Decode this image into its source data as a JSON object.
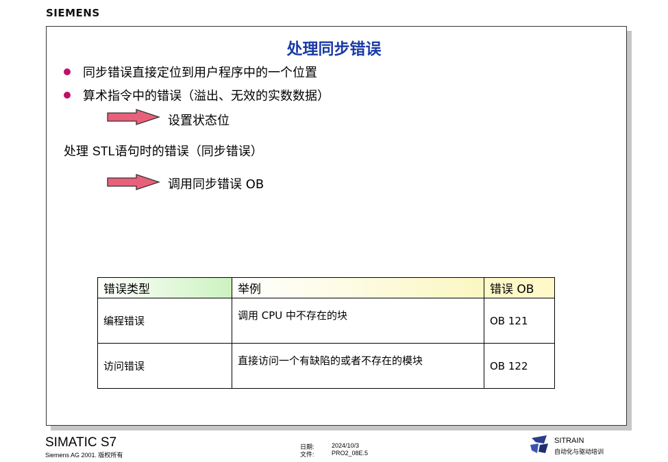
{
  "header": {
    "logo_text": "SIEMENS"
  },
  "slide": {
    "title": "处理同步错误",
    "bullets": [
      "同步错误直接定位到用户程序中的一个位置",
      "算术指令中的错误（溢出、无效的实数数据）"
    ],
    "arrow1_text": "设置状态位",
    "line_prefix": "处理 ",
    "line_stl": "STL",
    "line_suffix": "语句时的错误（同步错误）",
    "arrow2_text": "调用同步错误 OB"
  },
  "table": {
    "headers": [
      "错误类型",
      "举例",
      "错误 OB"
    ],
    "rows": [
      {
        "type": "编程错误",
        "example": "调用 CPU 中不存在的块",
        "ob": "OB 121"
      },
      {
        "type": "访问错误",
        "example": "直接访问一个有缺陷的或者不存在的模块",
        "ob": "OB 122"
      }
    ]
  },
  "footer": {
    "product": "SIMATIC S7",
    "copyright": "Siemens AG 2001. 版权所有",
    "date_label": "日期:",
    "date_value": "2024/10/3",
    "file_label": "文件:",
    "file_value": "PRO2_08E.5",
    "brand": "SITRAIN",
    "brand_sub": "自动化与驱动培训"
  },
  "colors": {
    "title": "#1a3aa6",
    "bullet": "#c0106a",
    "arrow_fill": "#e8607a"
  },
  "icons": [
    "arrow-right-icon",
    "sitrain-logo-icon"
  ]
}
